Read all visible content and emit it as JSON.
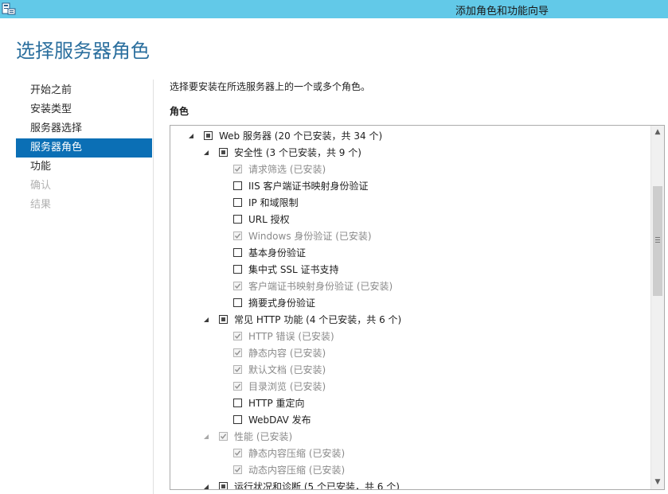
{
  "window": {
    "title": "添加角色和功能向导",
    "icon": "server-manager-icon"
  },
  "page": {
    "title": "选择服务器角色"
  },
  "nav": {
    "items": [
      {
        "label": "开始之前",
        "state": "normal"
      },
      {
        "label": "安装类型",
        "state": "normal"
      },
      {
        "label": "服务器选择",
        "state": "normal"
      },
      {
        "label": "服务器角色",
        "state": "active"
      },
      {
        "label": "功能",
        "state": "normal"
      },
      {
        "label": "确认",
        "state": "disabled"
      },
      {
        "label": "结果",
        "state": "disabled"
      }
    ]
  },
  "main": {
    "description": "选择要安装在所选服务器上的一个或多个角色。",
    "roles_heading": "角色",
    "tree": [
      {
        "label": "Web 服务器 (20 个已安装，共 34 个)",
        "level": 0,
        "expander": "expanded",
        "check": "partial",
        "installed": false
      },
      {
        "label": "安全性 (3 个已安装，共 9 个)",
        "level": 1,
        "expander": "expanded",
        "check": "partial",
        "installed": false
      },
      {
        "label": "请求筛选 (已安装)",
        "level": 2,
        "expander": "none",
        "check": "checked",
        "installed": true
      },
      {
        "label": "IIS 客户端证书映射身份验证",
        "level": 2,
        "expander": "none",
        "check": "unchecked",
        "installed": false
      },
      {
        "label": "IP 和域限制",
        "level": 2,
        "expander": "none",
        "check": "unchecked",
        "installed": false
      },
      {
        "label": "URL 授权",
        "level": 2,
        "expander": "none",
        "check": "unchecked",
        "installed": false
      },
      {
        "label": "Windows 身份验证 (已安装)",
        "level": 2,
        "expander": "none",
        "check": "checked",
        "installed": true
      },
      {
        "label": "基本身份验证",
        "level": 2,
        "expander": "none",
        "check": "unchecked",
        "installed": false
      },
      {
        "label": "集中式 SSL 证书支持",
        "level": 2,
        "expander": "none",
        "check": "unchecked",
        "installed": false
      },
      {
        "label": "客户端证书映射身份验证 (已安装)",
        "level": 2,
        "expander": "none",
        "check": "checked",
        "installed": true
      },
      {
        "label": "摘要式身份验证",
        "level": 2,
        "expander": "none",
        "check": "unchecked",
        "installed": false
      },
      {
        "label": "常见 HTTP 功能 (4 个已安装，共 6 个)",
        "level": 1,
        "expander": "expanded",
        "check": "partial",
        "installed": false
      },
      {
        "label": "HTTP 错误 (已安装)",
        "level": 2,
        "expander": "none",
        "check": "checked",
        "installed": true
      },
      {
        "label": "静态内容 (已安装)",
        "level": 2,
        "expander": "none",
        "check": "checked",
        "installed": true
      },
      {
        "label": "默认文档 (已安装)",
        "level": 2,
        "expander": "none",
        "check": "checked",
        "installed": true
      },
      {
        "label": "目录浏览 (已安装)",
        "level": 2,
        "expander": "none",
        "check": "checked",
        "installed": true
      },
      {
        "label": "HTTP 重定向",
        "level": 2,
        "expander": "none",
        "check": "unchecked",
        "installed": false
      },
      {
        "label": "WebDAV 发布",
        "level": 2,
        "expander": "none",
        "check": "unchecked",
        "installed": false
      },
      {
        "label": "性能 (已安装)",
        "level": 1,
        "expander": "expanded-disabled",
        "check": "checked",
        "installed": true
      },
      {
        "label": "静态内容压缩 (已安装)",
        "level": 2,
        "expander": "none",
        "check": "checked",
        "installed": true
      },
      {
        "label": "动态内容压缩 (已安装)",
        "level": 2,
        "expander": "none",
        "check": "checked",
        "installed": true
      },
      {
        "label": "运行状况和诊断 (5 个已安装，共 6 个)",
        "level": 1,
        "expander": "expanded",
        "check": "partial",
        "installed": false
      }
    ]
  },
  "scrollbar": {
    "up_glyph": "▲",
    "down_glyph": "▼"
  },
  "colors": {
    "titlebar": "#62c9e8",
    "accent": "#0b6fb5",
    "page_title": "#2b6f9e",
    "disabled_text": "#b2b2b2",
    "installed_text": "#8a8a8a"
  }
}
